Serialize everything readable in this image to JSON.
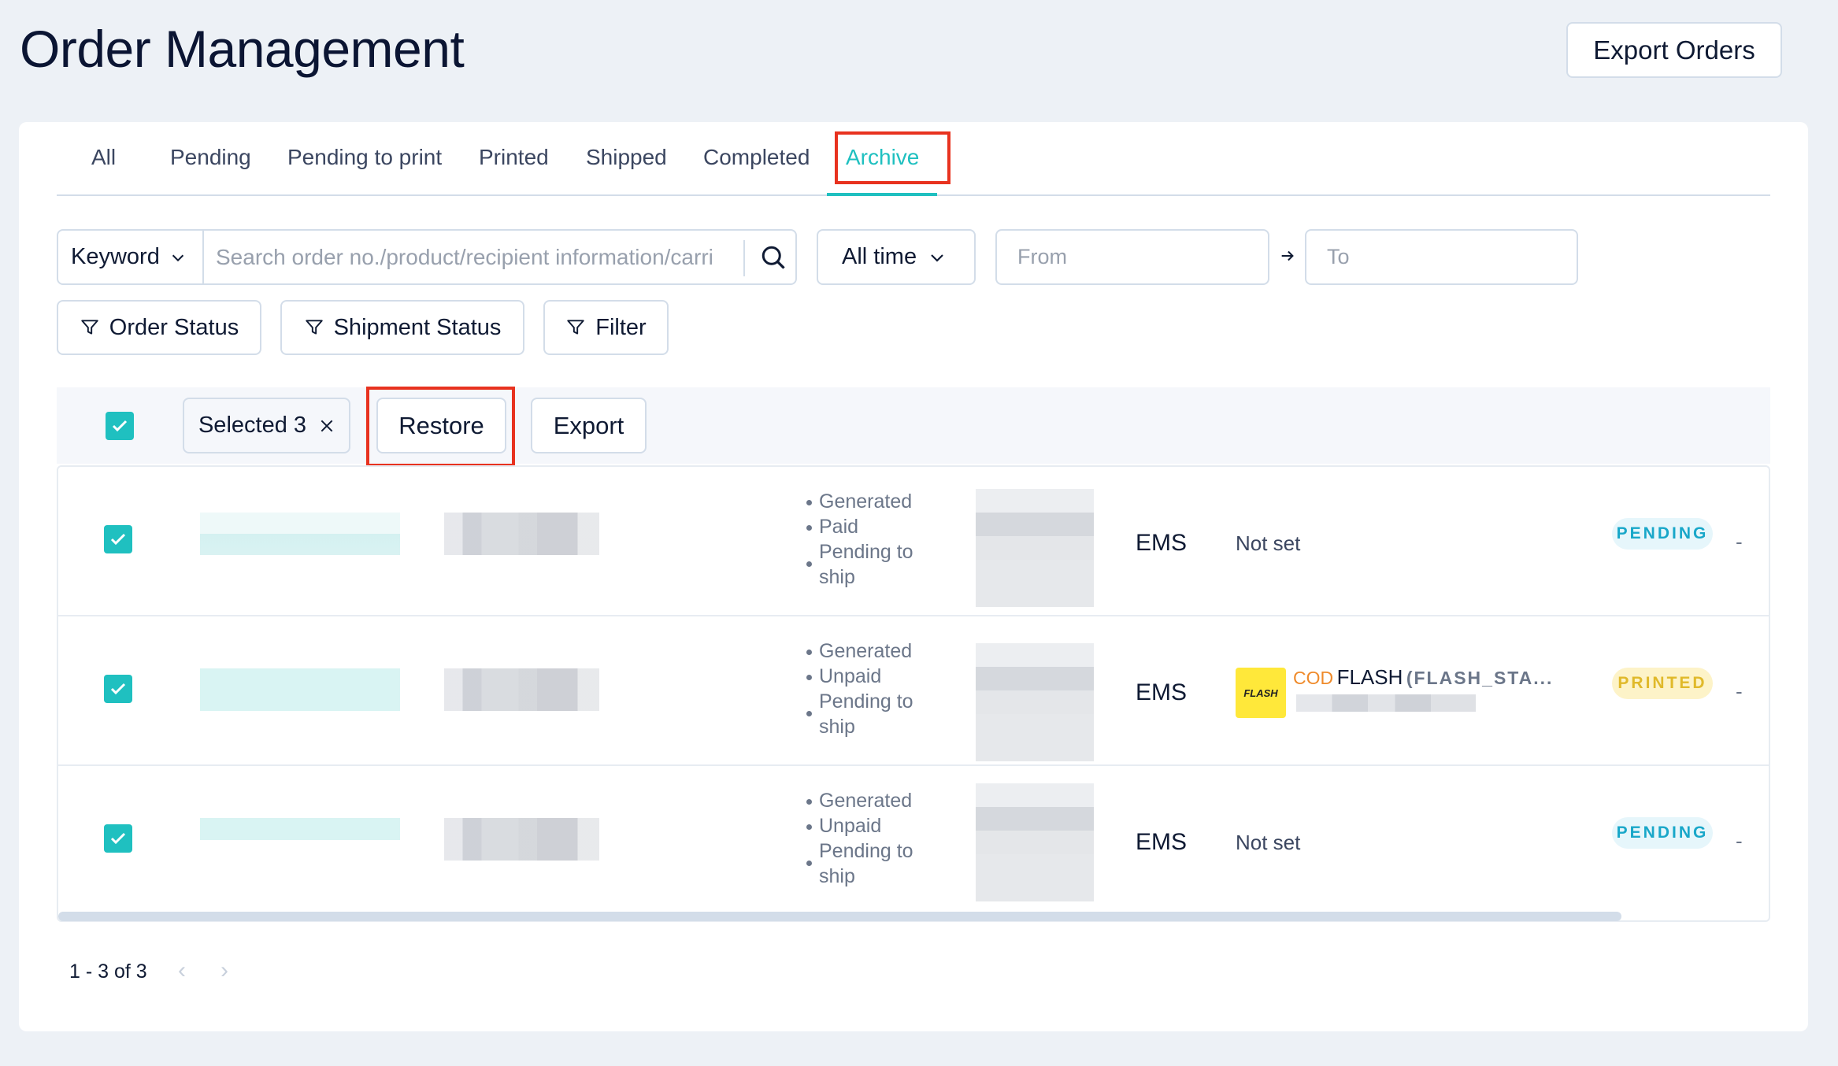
{
  "header": {
    "title": "Order Management",
    "export_orders_label": "Export Orders"
  },
  "tabs": [
    {
      "label": "All",
      "active": false
    },
    {
      "label": "Pending",
      "active": false
    },
    {
      "label": "Pending to print",
      "active": false
    },
    {
      "label": "Printed",
      "active": false
    },
    {
      "label": "Shipped",
      "active": false
    },
    {
      "label": "Completed",
      "active": false
    },
    {
      "label": "Archive",
      "active": true
    }
  ],
  "search": {
    "keyword_select": "Keyword",
    "placeholder": "Search order no./product/recipient information/carri",
    "value": "",
    "time_select": "All time",
    "from_placeholder": "From",
    "to_placeholder": "To"
  },
  "filters": {
    "order_status": "Order Status",
    "shipment_status": "Shipment Status",
    "filter": "Filter"
  },
  "toolbar": {
    "selected_label": "Selected 3",
    "restore_label": "Restore",
    "export_label": "Export"
  },
  "rows": [
    {
      "checked": true,
      "statuses": [
        "Generated",
        "Paid",
        "Pending to ship"
      ],
      "carrier": "EMS",
      "logistics": "Not set",
      "badge": "PENDING",
      "last": "-"
    },
    {
      "checked": true,
      "statuses": [
        "Generated",
        "Unpaid",
        "Pending to ship"
      ],
      "carrier": "EMS",
      "logistics": {
        "cod": "COD",
        "name": "FLASH",
        "code": "(FLASH_STA...",
        "logo_text": "FLASH"
      },
      "badge": "PRINTED",
      "last": "-"
    },
    {
      "checked": true,
      "statuses": [
        "Generated",
        "Unpaid",
        "Pending to ship"
      ],
      "carrier": "EMS",
      "logistics": "Not set",
      "badge": "PENDING",
      "last": "-"
    }
  ],
  "pagination": {
    "range_text": "1 - 3 of 3",
    "prev": "‹",
    "next": "›"
  },
  "colors": {
    "accent": "#1fc0c0",
    "highlight_box": "#e8321f",
    "pending_badge": "#19a7c9",
    "printed_badge": "#e0b92a"
  }
}
